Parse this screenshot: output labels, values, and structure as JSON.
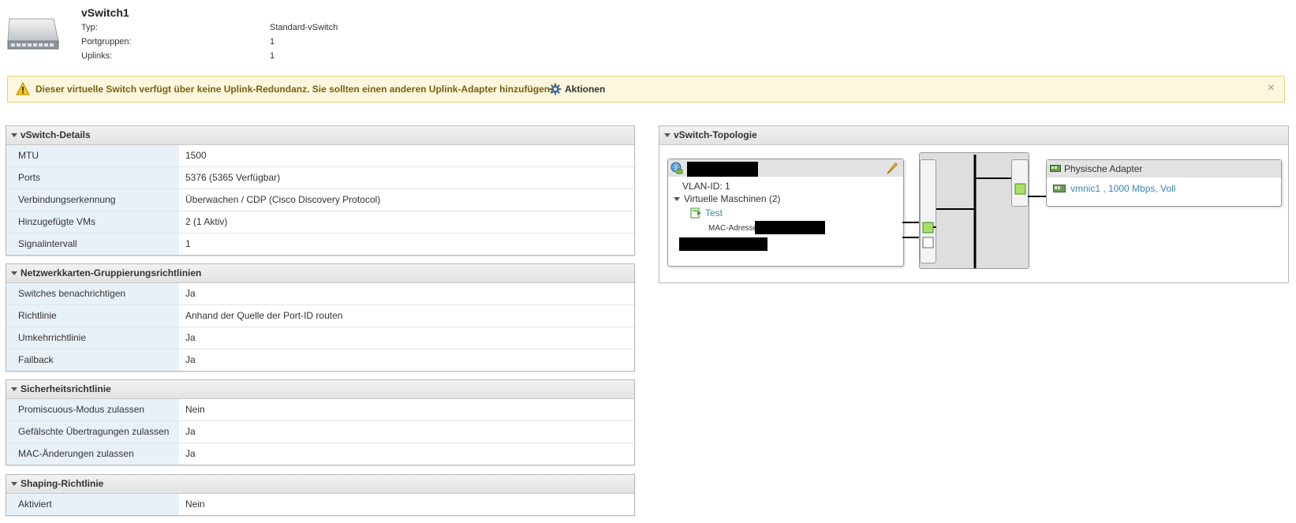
{
  "header": {
    "title": "vSwitch1",
    "rows": [
      {
        "label": "Typ:",
        "value": "Standard-vSwitch"
      },
      {
        "label": "Portgruppen:",
        "value": "1"
      },
      {
        "label": "Uplinks:",
        "value": "1"
      }
    ],
    "icon": "switch-icon"
  },
  "warning": {
    "text": "Dieser virtuelle Switch verfügt über keine Uplink-Redundanz. Sie sollten einen anderen Uplink-Adapter hinzufügen.",
    "actions_label": "Aktionen",
    "close_glyph": "×"
  },
  "panels": {
    "details": {
      "title": "vSwitch-Details",
      "rows": [
        {
          "label": "MTU",
          "value": "1500"
        },
        {
          "label": "Ports",
          "value": "5376 (5365 Verfügbar)"
        },
        {
          "label": "Verbindungserkennung",
          "value": "Überwachen / CDP (Cisco Discovery Protocol)"
        },
        {
          "label": "Hinzugefügte VMs",
          "value": "2 (1 Aktiv)"
        },
        {
          "label": "Signalintervall",
          "value": "1"
        }
      ]
    },
    "teaming": {
      "title": "Netzwerkkarten-Gruppierungsrichtlinien",
      "rows": [
        {
          "label": "Switches benachrichtigen",
          "value": "Ja"
        },
        {
          "label": "Richtlinie",
          "value": "Anhand der Quelle der Port-ID routen"
        },
        {
          "label": "Umkehrrichtlinie",
          "value": "Ja"
        },
        {
          "label": "Failback",
          "value": "Ja"
        }
      ]
    },
    "security": {
      "title": "Sicherheitsrichtlinie",
      "rows": [
        {
          "label": "Promiscuous-Modus zulassen",
          "value": "Nein"
        },
        {
          "label": "Gefälschte Übertragungen zulassen",
          "value": "Ja"
        },
        {
          "label": "MAC-Änderungen zulassen",
          "value": "Ja"
        }
      ]
    },
    "shaping": {
      "title": "Shaping-Richtlinie",
      "rows": [
        {
          "label": "Aktiviert",
          "value": "Nein"
        }
      ]
    }
  },
  "topology": {
    "title": "vSwitch-Topologie",
    "portgroup": {
      "vlan": "VLAN-ID: 1",
      "vms_label": "Virtuelle Maschinen (2)",
      "vm_name": "Test",
      "mac_label": "MAC-Adresse"
    },
    "physical": {
      "title": "Physische Adapter",
      "adapter": "vmnic1 , 1000 Mbps, Voll"
    },
    "colors": {
      "port_active": "#a8e06a",
      "port_inactive": "#ffffff"
    }
  }
}
